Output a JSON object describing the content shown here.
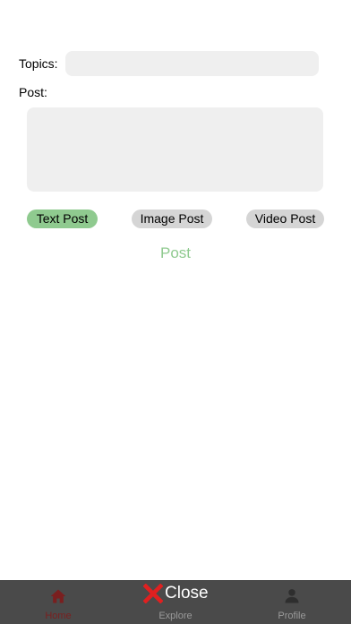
{
  "form": {
    "topics_label": "Topics:",
    "topics_value": "",
    "post_label": "Post:",
    "post_value": ""
  },
  "post_types": [
    {
      "label": "Text Post",
      "selected": true
    },
    {
      "label": "Image Post",
      "selected": false
    },
    {
      "label": "Video Post",
      "selected": false
    }
  ],
  "submit_label": "Post",
  "tabbar": {
    "home": {
      "label": "Home",
      "icon": "home-icon",
      "color": "#7a1f1f"
    },
    "explore": {
      "label": "Explore",
      "color": "#9a9a9a"
    },
    "profile": {
      "label": "Profile",
      "icon": "person-icon",
      "color": "#9a9a9a"
    }
  },
  "close_overlay": {
    "label": "Close",
    "icon": "close-icon",
    "icon_color": "#e02020"
  },
  "colors": {
    "accent": "#8fca8f",
    "field_bg": "#efefef",
    "pill_inactive": "#d5d5d5",
    "tabbar_bg": "#4a4a4a"
  }
}
